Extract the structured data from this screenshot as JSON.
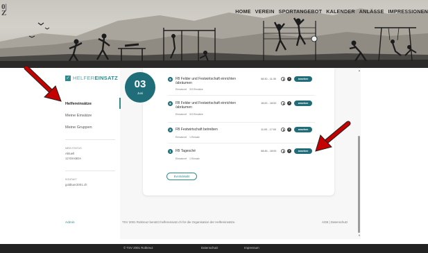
{
  "header": {
    "logo_fragment": "0|\nZ",
    "nav": [
      "HOME",
      "VEREIN",
      "SPORTANGEBOT",
      "KALENDER",
      "ANLÄSSE",
      "IMPRESSIONEN"
    ]
  },
  "sidebar": {
    "brand_prefix": "HELFER",
    "brand_suffix": "EINSATZ",
    "items": [
      {
        "label": "Helfereinsätze",
        "active": true
      },
      {
        "label": "Meine Einsätze",
        "active": false
      },
      {
        "label": "Meine Gruppen",
        "active": false
      }
    ],
    "stats_label": "MEIN STATUS",
    "stats_sub": "Aktuell",
    "stats_value": "12 Einsätze",
    "contact_label": "KONTAKT",
    "contact_value": "goldtuer2001.ch",
    "admin_label": "Admin"
  },
  "event": {
    "day": "03",
    "month": "Juni",
    "details_label": "Eventdetails",
    "tasks": [
      {
        "num": "6",
        "title": "FB Felder und Festwirtschaft einrichten /abräumen",
        "time": "08:30 - 11:30",
        "meta_key": "Einsatzort",
        "meta_val": "3/3 Einsätze",
        "button": "ansehen"
      },
      {
        "num": "6",
        "title": "FB Felder und Festwirtschaft einrichten /abräumen",
        "time": "16:00 - 18:00",
        "meta_key": "Einsatzort",
        "meta_val": "3/3 Einsätze",
        "button": "ansehen"
      },
      {
        "num": "2",
        "title": "FB Festwirtschaft betreiben",
        "time": "11:00 - 17:00",
        "meta_key": "Einsatzort",
        "meta_val": "1 Einsatz",
        "button": "ansehen"
      },
      {
        "num": "1",
        "title": "FB Tagesché",
        "time": "08:45 - 18:00",
        "meta_key": "Einsatzort",
        "meta_val": "1 Einsatz",
        "button": "ansehen"
      }
    ]
  },
  "footer": {
    "text": "TSV 2001 Rotkreuz benützt helfereinsatz.ch für die Organisation der Helfereinsätze.",
    "links": "AGB  |  Datenschutz"
  },
  "bottombar": {
    "copyright": "© TSV 2001 Rotkreuz",
    "link1": "Datenschutz",
    "link2": "Impressum"
  },
  "colors": {
    "accent": "#1f6d78",
    "brand": "#2d8a8c",
    "arrow": "#c40000"
  }
}
